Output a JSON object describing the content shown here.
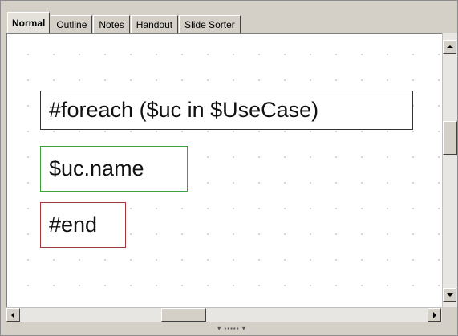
{
  "tabs": [
    {
      "label": "Normal",
      "active": true
    },
    {
      "label": "Outline"
    },
    {
      "label": "Notes"
    },
    {
      "label": "Handout"
    },
    {
      "label": "Slide Sorter"
    }
  ],
  "slide": {
    "foreach_text": "#foreach ($uc in $UseCase)",
    "name_text": "$uc.name",
    "end_text": "#end"
  },
  "colors": {
    "foreach_border": "#333333",
    "name_border": "#3aa33a",
    "end_border": "#a03a3a"
  },
  "icons": {
    "scroll_up": "arrow-up-icon",
    "scroll_down": "arrow-down-icon",
    "scroll_left": "arrow-left-icon",
    "scroll_right": "arrow-right-icon",
    "resize_grip": "grip-icon"
  }
}
